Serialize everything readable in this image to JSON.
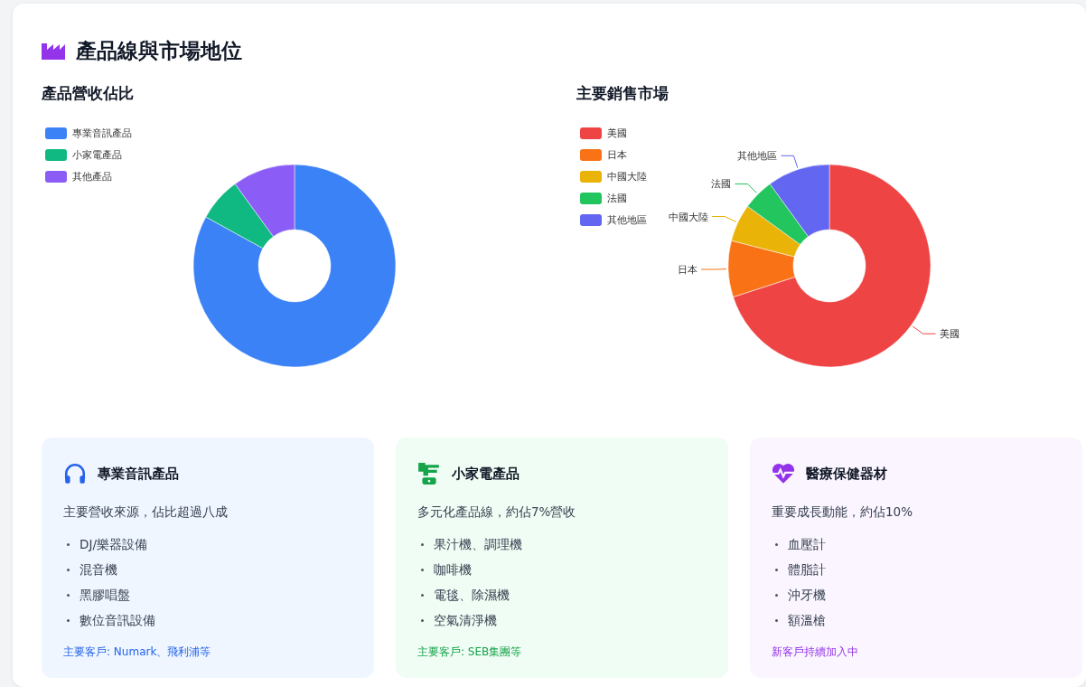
{
  "title": "產品線與市場地位",
  "charts": [
    {
      "title": "產品營收佔比",
      "chart_data": {
        "type": "donut",
        "categories": [
          "專業音訊產品",
          "小家電產品",
          "其他產品"
        ],
        "values": [
          83,
          7,
          10
        ],
        "colors": [
          "#3b82f6",
          "#10b981",
          "#8b5cf6"
        ],
        "legend": true
      }
    },
    {
      "title": "主要銷售市場",
      "chart_data": {
        "type": "donut",
        "categories": [
          "美國",
          "日本",
          "中國大陸",
          "法國",
          "其他地區"
        ],
        "values": [
          70,
          9,
          6,
          5,
          10
        ],
        "colors": [
          "#ef4444",
          "#f97316",
          "#eab308",
          "#22c55e",
          "#6366f1"
        ],
        "legend": true
      },
      "slice_name_labels": true
    }
  ],
  "cards": [
    {
      "kind": "audio",
      "title": "專業音訊產品",
      "description": "主要營收來源，佔比超過八成",
      "items": [
        "DJ/樂器設備",
        "混音機",
        "黑膠唱盤",
        "數位音訊設備"
      ],
      "footer": "主要客戶: Numark、飛利浦等"
    },
    {
      "kind": "appliance",
      "title": "小家電產品",
      "description": "多元化產品線，約佔7%營收",
      "items": [
        "果汁機、調理機",
        "咖啡機",
        "電毯、除濕機",
        "空氣清淨機"
      ],
      "footer": "主要客戶: SEB集團等"
    },
    {
      "kind": "medical",
      "title": "醫療保健器材",
      "description": "重要成長動能，約佔10%",
      "items": [
        "血壓計",
        "體脂計",
        "沖牙機",
        "額溫槍"
      ],
      "footer": "新客戶持續加入中"
    }
  ]
}
